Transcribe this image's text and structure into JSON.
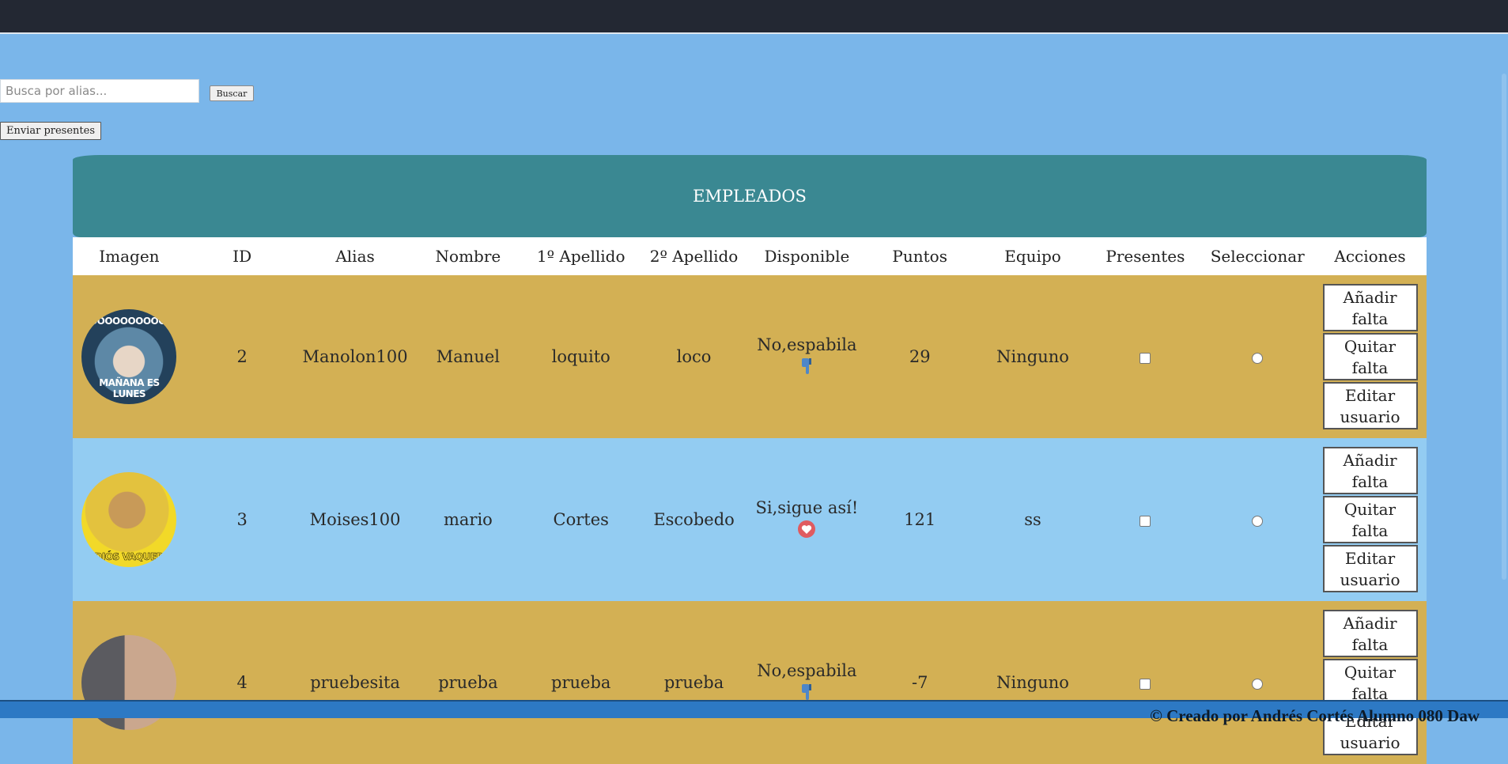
{
  "search": {
    "placeholder": "Busca por alias...",
    "button_label": "Buscar"
  },
  "send_presents_label": "Enviar presentes",
  "table": {
    "title": "EMPLEADOS",
    "headers": [
      "Imagen",
      "ID",
      "Alias",
      "Nombre",
      "1º Apellido",
      "2º Apellido",
      "Disponible",
      "Puntos",
      "Equipo",
      "Presentes",
      "Seleccionar",
      "Acciones"
    ],
    "rows": [
      {
        "image_caption_top": "NOOOOOOOOOOOO",
        "image_caption_bottom": "MAÑANA ES LUNES",
        "id": "2",
        "alias": "Manolon100",
        "nombre": "Manuel",
        "apellido1": "loquito",
        "apellido2": "loco",
        "disponible": "No,espabila",
        "disponible_icon": "thumbs-down-icon",
        "puntos": "29",
        "equipo": "Ninguno",
        "actions": [
          "Añadir falta",
          "Quitar falta",
          "Editar usuario"
        ]
      },
      {
        "image_caption_top": "",
        "image_caption_bottom": "ADIÓS VAQUERO",
        "id": "3",
        "alias": "Moises100",
        "nombre": "mario",
        "apellido1": "Cortes",
        "apellido2": "Escobedo",
        "disponible": "Si,sigue así!",
        "disponible_icon": "heart-icon",
        "puntos": "121",
        "equipo": "ss",
        "actions": [
          "Añadir falta",
          "Quitar falta",
          "Editar usuario"
        ]
      },
      {
        "image_caption_top": "",
        "image_caption_bottom": "",
        "id": "4",
        "alias": "pruebesita",
        "nombre": "prueba",
        "apellido1": "prueba",
        "apellido2": "prueba",
        "disponible": "No,espabila",
        "disponible_icon": "thumbs-down-icon",
        "puntos": "-7",
        "equipo": "Ninguno",
        "actions": [
          "Añadir falta",
          "Quitar falta",
          "Editar usuario"
        ]
      }
    ]
  },
  "footer": {
    "text": "© Creado por Andrés Cortés Alumno 080 Daw"
  },
  "colors": {
    "topbar": "#232833",
    "background": "#7ab6ea",
    "title_bar": "#3a8892",
    "row_gold": "#d3b054",
    "row_blue": "#93ccf2",
    "footer": "#2d79c4"
  }
}
